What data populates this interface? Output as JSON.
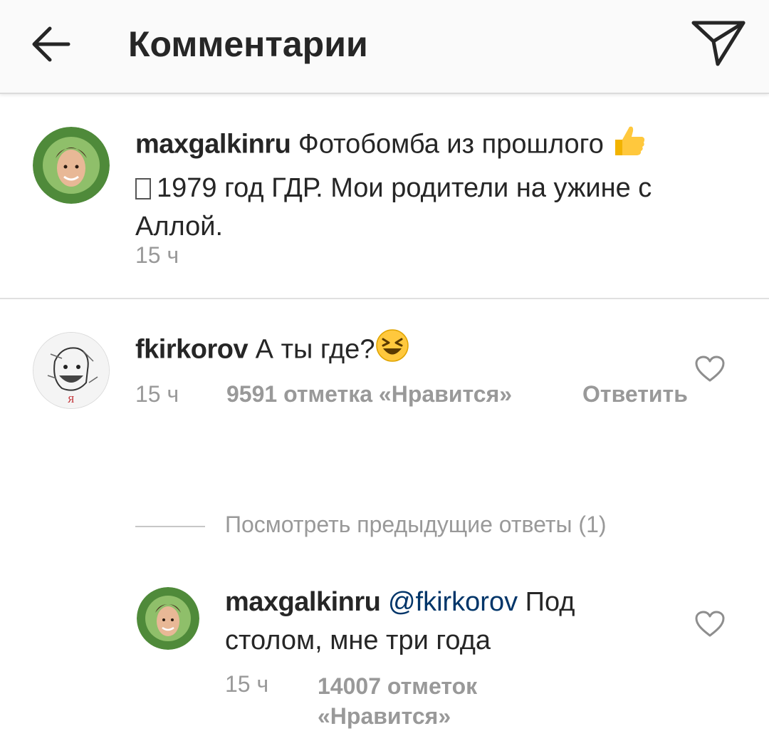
{
  "header": {
    "title": "Комментарии",
    "back_icon": "arrow-left-icon",
    "send_icon": "paper-plane-icon"
  },
  "caption": {
    "username": "maxgalkinru",
    "text_part1": " Фотобомба из прошлого ",
    "text_part2": "1979 год ГДР. Мои родители на ужине с Аллой.",
    "time": "15 ч"
  },
  "comments": [
    {
      "username": "fkirkorov",
      "text": " А ты где?",
      "time": "15 ч",
      "likes": "9591 отметка «Нравится»",
      "reply": "Ответить"
    }
  ],
  "view_previous": "Посмотреть предыдущие ответы (1)",
  "replies": [
    {
      "username": "maxgalkinru",
      "mention": "@fkirkorov",
      "text": " Под столом, мне три года",
      "time": "15 ч",
      "likes": "14007 отметок «Нравится»"
    }
  ],
  "colors": {
    "accent_link": "#003569",
    "meta_gray": "#999999",
    "text": "#262626"
  }
}
